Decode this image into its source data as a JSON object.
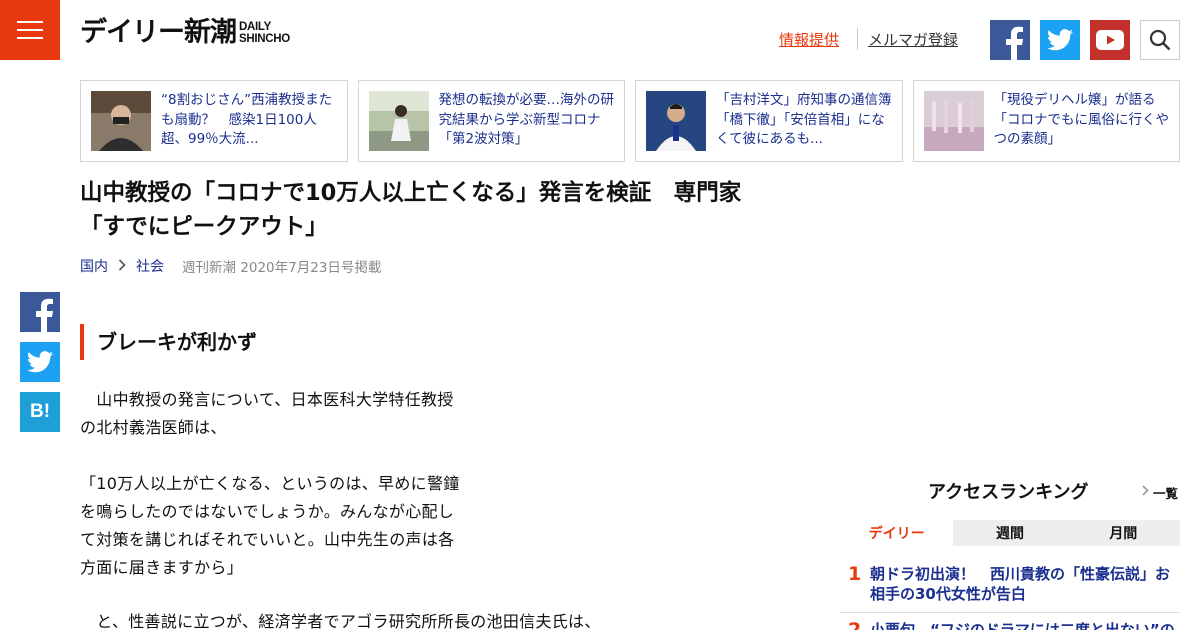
{
  "header": {
    "logo_main": "デイリー新潮",
    "logo_sub_1": "DAILY",
    "logo_sub_2": "SHINCHO",
    "link_info": "情報提供",
    "link_mail": "メルマガ登録"
  },
  "featured": [
    {
      "text": "“8割おじさん”西浦教授またも扇動？　感染1日100人超、99％大流..."
    },
    {
      "text": "発想の転換が必要…海外の研究結果から学ぶ新型コロナ「第2波対策」"
    },
    {
      "text": "「吉村洋文」府知事の通信簿　「橋下徹」「安倍首相」になくて彼にあるも..."
    },
    {
      "text": "「現役デリヘル嬢」が語る「コロナでもに風俗に行くやつの素顔」"
    }
  ],
  "article": {
    "title": "山中教授の「コロナで10万人以上亡くなる」発言を検証　専門家「すでにピークアウト」",
    "crumb_1": "国内",
    "crumb_2": "社会",
    "pubinfo": "週刊新潮 2020年7月23日号掲載",
    "section_heading": "ブレーキが利かず",
    "para_1_line_1": "　山中教授の発言について、日本医科大学特任教授",
    "para_1_line_2": "の北村義浩医師は、",
    "para_2_line_1": "「10万人以上が亡くなる、というのは、早めに警鐘",
    "para_2_line_2": "を鳴らしたのではないでしょうか。みんなが心配し",
    "para_2_line_3": "て対策を講じればそれでいいと。山中先生の声は各",
    "para_2_line_4": "方面に届きますから」",
    "para_3_line_1": "　と、性善説に立つが、経済学者でアゴラ研究所所長の池田信夫氏は、"
  },
  "ranking": {
    "title": "アクセスランキング",
    "more": "一覧",
    "tabs": [
      "デイリー",
      "週間",
      "月間"
    ],
    "active_tab": "デイリー",
    "items": [
      {
        "rank": "1",
        "text": "朝ドラ初出演！　西川貴教の「性豪伝説」お相手の30代女性が告白"
      },
      {
        "rank": "2",
        "text": "小栗旬、“フジのドラマには二度と出ない”の激怒"
      }
    ]
  },
  "colors": {
    "accent": "#e8380d",
    "link": "#1b2f8f",
    "facebook": "#3b5998",
    "twitter": "#1da1f2",
    "youtube": "#c4302b",
    "hatena": "#1e9fd8"
  },
  "icons": [
    "menu-icon",
    "facebook-icon",
    "twitter-icon",
    "youtube-icon",
    "search-icon",
    "hatena-bookmark-icon",
    "chevron-right-icon"
  ]
}
